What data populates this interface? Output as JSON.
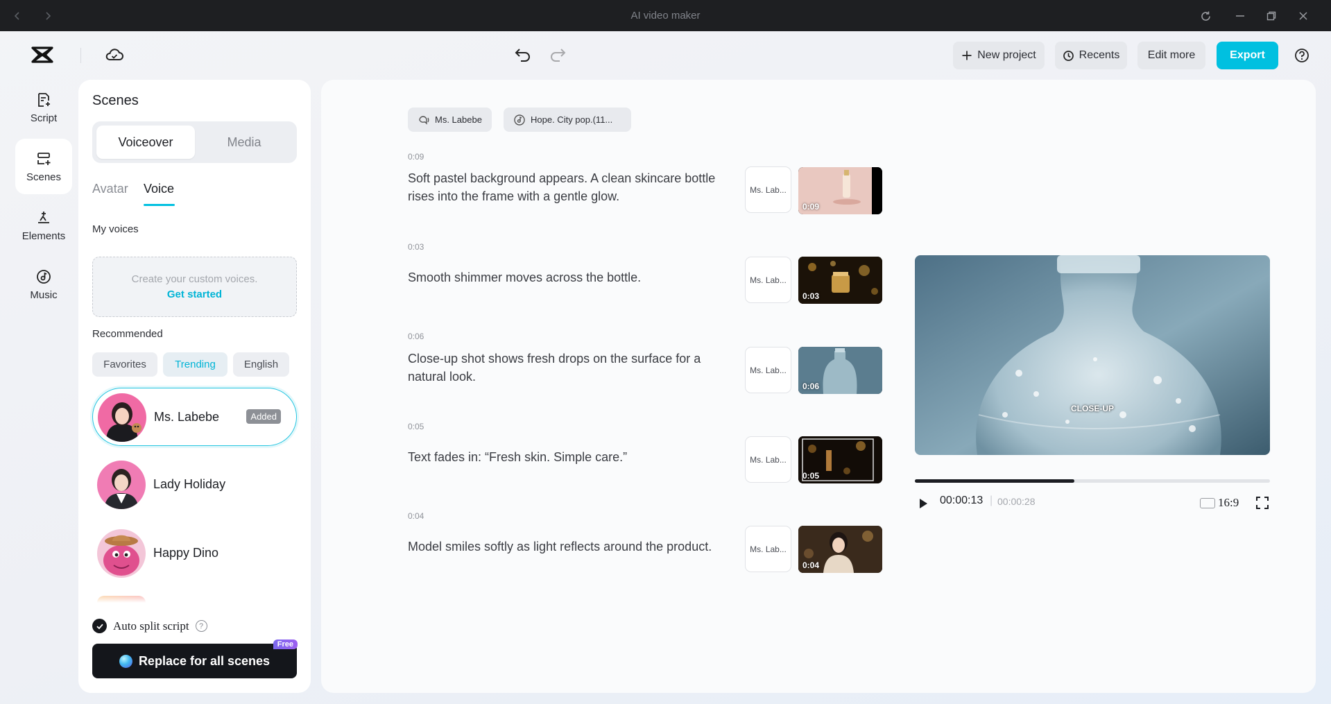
{
  "window": {
    "title": "AI video maker"
  },
  "toolbar": {
    "new_project": "New project",
    "recents": "Recents",
    "edit_more": "Edit more",
    "export": "Export"
  },
  "rail": [
    {
      "label": "Script",
      "icon": "script-icon"
    },
    {
      "label": "Scenes",
      "icon": "scenes-icon",
      "active": true
    },
    {
      "label": "Elements",
      "icon": "elements-icon"
    },
    {
      "label": "Music",
      "icon": "music-icon"
    }
  ],
  "panel": {
    "title": "Scenes",
    "segments": [
      "Voiceover",
      "Media"
    ],
    "active_segment": "Voiceover",
    "subtabs": [
      "Avatar",
      "Voice"
    ],
    "active_subtab": "Voice",
    "my_voices_label": "My voices",
    "create_text": "Create your custom voices.",
    "get_started": "Get started",
    "recommended_label": "Recommended",
    "filters": [
      "Favorites",
      "Trending",
      "English"
    ],
    "active_filter": "Trending",
    "voices": [
      {
        "name": "Ms. Labebe",
        "badge": "Added",
        "selected": true
      },
      {
        "name": "Lady Holiday"
      },
      {
        "name": "Happy Dino"
      }
    ],
    "auto_split_label": "Auto split script",
    "auto_split_checked": true,
    "replace_button": "Replace for all scenes",
    "free_tag": "Free"
  },
  "main": {
    "voice_pill": "Ms. Labebe",
    "music_pill": "Hope. City pop.(11...",
    "scenes": [
      {
        "time": "0:09",
        "text": "Soft pastel background appears. A clean skincare bottle rises into the frame with a gentle glow.",
        "voice": "Ms. Lab...",
        "thumb_time": "0:09"
      },
      {
        "time": "0:03",
        "text": "Smooth shimmer moves across the bottle.",
        "voice": "Ms. Lab...",
        "thumb_time": "0:03"
      },
      {
        "time": "0:06",
        "text": "Close-up shot shows fresh drops on the surface for a natural look.",
        "voice": "Ms. Lab...",
        "thumb_time": "0:06"
      },
      {
        "time": "0:05",
        "text": "Text fades in: “Fresh skin. Simple care.”",
        "voice": "Ms. Lab...",
        "thumb_time": "0:05"
      },
      {
        "time": "0:04",
        "text": "Model smiles softly as light reflects around the product.",
        "voice": "Ms. Lab...",
        "thumb_time": "0:04"
      }
    ]
  },
  "preview": {
    "overlay_text": "CLOSE-UP",
    "current_time": "00:00:13",
    "total_time": "00:00:28",
    "progress": 0.45,
    "aspect_ratio": "16:9"
  },
  "colors": {
    "accent": "#00c0e0",
    "dark_button": "#14161b",
    "added_badge": "#8d9096"
  }
}
